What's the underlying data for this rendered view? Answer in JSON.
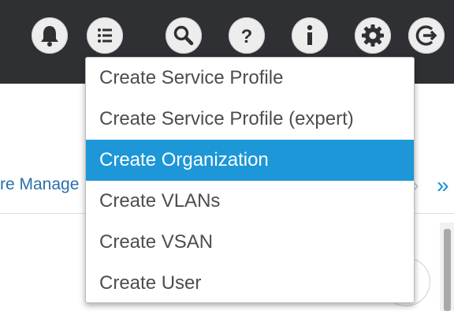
{
  "toolbar": {
    "icons": [
      "bell-icon",
      "list-icon",
      "search-icon",
      "help-icon",
      "info-icon",
      "gear-icon",
      "logout-icon"
    ],
    "help_glyph": "?",
    "background": "#2e3034"
  },
  "page": {
    "nav_text": "re Manage",
    "chevron_small": "›",
    "chevron_double": "»"
  },
  "menu": {
    "items": [
      {
        "label": "Create Service Profile",
        "active": false
      },
      {
        "label": "Create Service Profile (expert)",
        "active": false
      },
      {
        "label": "Create Organization",
        "active": true
      },
      {
        "label": "Create VLANs",
        "active": false
      },
      {
        "label": "Create VSAN",
        "active": false
      },
      {
        "label": "Create User",
        "active": false
      }
    ],
    "active_color": "#1d97d8"
  }
}
